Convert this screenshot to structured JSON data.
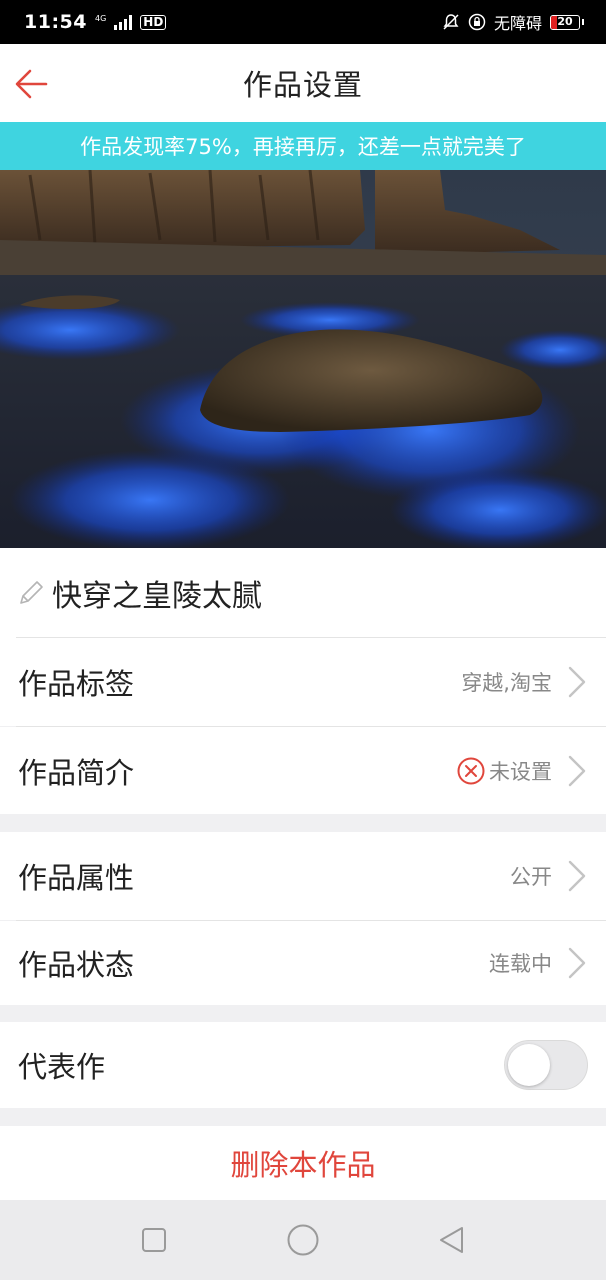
{
  "status_bar": {
    "time": "11:54",
    "network": "4G",
    "hd_badge": "HD",
    "accessibility_label": "无障碍",
    "battery_level": "20",
    "battery_fraction": 0.2
  },
  "header": {
    "title": "作品设置"
  },
  "banner": {
    "text": "作品发现率75%，再接再厉，还差一点就完美了"
  },
  "work": {
    "title": "快穿之皇陵太腻"
  },
  "settings": {
    "tags_label": "作品标签",
    "tags_value": "穿越,淘宝",
    "intro_label": "作品简介",
    "intro_value": "未设置",
    "attribute_label": "作品属性",
    "attribute_value": "公开",
    "status_label": "作品状态",
    "status_value": "连载中",
    "representative_label": "代表作",
    "representative_enabled": false
  },
  "actions": {
    "delete_label": "删除本作品"
  },
  "colors": {
    "accent": "#e0463c",
    "banner_bg": "#3fd4e0",
    "status_bar_bg": "#000000"
  },
  "icons": {
    "back": "back-arrow-icon",
    "pencil": "pencil-icon",
    "chevron": "chevron-right-icon",
    "not_set": "x-circle-icon"
  }
}
